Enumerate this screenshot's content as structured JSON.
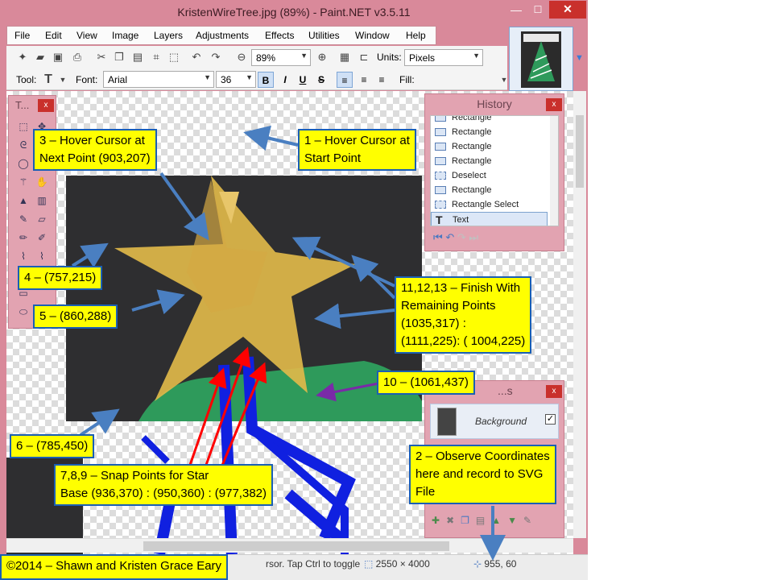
{
  "window": {
    "title": "KristenWireTree.jpg (89%) - Paint.NET v3.5.11",
    "minimize": "—",
    "maximize": "☐",
    "close": "✕"
  },
  "menu": [
    "File",
    "Edit",
    "View",
    "Image",
    "Layers",
    "Adjustments",
    "Effects",
    "Utilities",
    "Window",
    "Help"
  ],
  "toolbar": {
    "zoom_value": "89%",
    "units_label": "Units:",
    "units_value": "Pixels",
    "tool_label": "Tool:",
    "font_label": "Font:",
    "font_value": "Arial",
    "font_size": "36",
    "bold": "B",
    "italic": "I",
    "underline": "U",
    "strike": "S",
    "fill_label": "Fill:"
  },
  "tools_panel": {
    "title": "T...",
    "close": "x"
  },
  "history_panel": {
    "title": "History",
    "close": "x",
    "items": [
      {
        "label": "Rectangle"
      },
      {
        "label": "Rectangle"
      },
      {
        "label": "Rectangle"
      },
      {
        "label": "Rectangle"
      },
      {
        "label": "Deselect"
      },
      {
        "label": "Rectangle"
      },
      {
        "label": "Rectangle Select"
      },
      {
        "label": "Text"
      }
    ],
    "selected_index": 7
  },
  "layers_panel": {
    "title": "...s",
    "close": "x",
    "layer_name": "Background",
    "visible": true
  },
  "status": {
    "hint": "rsor. Tap Ctrl to toggle",
    "image_size": "2550 × 4000",
    "coords": "955, 60"
  },
  "annotations": {
    "c1": "1 – Hover Cursor at\nStart Point",
    "c2": "2 – Observe Coordinates\nhere and record to SVG\nFile",
    "c3": "3 – Hover Cursor at\nNext Point (903,207)",
    "c4": "4 – (757,215)",
    "c5": "5 – (860,288)",
    "c6": "6 – (785,450)",
    "c7": "7,8,9 – Snap Points for Star\nBase (936,370) : (950,360) : (977,382)",
    "c10": "10 – (1061,437)",
    "c11": "11,12,13 – Finish With\nRemaining Points\n(1035,317) :\n(1111,225): ( 1004,225)",
    "copyright": "©2014  – Shawn and Kristen Grace Eary"
  },
  "colors": {
    "window_frame": "#d9899a",
    "callout_fill": "#ffff00",
    "callout_border": "#1a5fb4",
    "star": "#e0b84a",
    "tree_green": "#2e9a5b",
    "wire_blue": "#1020e0",
    "arrow_red": "#ff0000",
    "arrow_blue": "#4a7fc1",
    "arrow_purple": "#7a2aa8"
  }
}
